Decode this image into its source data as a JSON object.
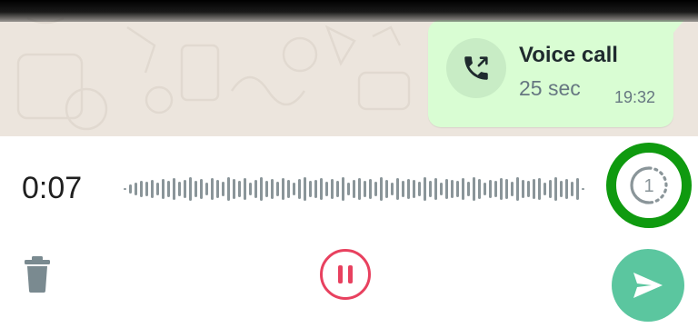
{
  "colors": {
    "chat_background": "#ece5dd",
    "bubble": "#d9fdd3",
    "pause_accent": "#e8415f",
    "send_button": "#5bc69f",
    "highlight_ring": "#0f9a0f"
  },
  "message": {
    "icon": "outgoing-call-icon",
    "title": "Voice call",
    "duration": "25 sec",
    "time": "19:32"
  },
  "recorder": {
    "elapsed": "0:07",
    "playback_speed": "1",
    "icons": {
      "speed": "playback-speed-icon",
      "delete": "trash-icon",
      "pause": "pause-icon",
      "send": "send-icon"
    }
  }
}
